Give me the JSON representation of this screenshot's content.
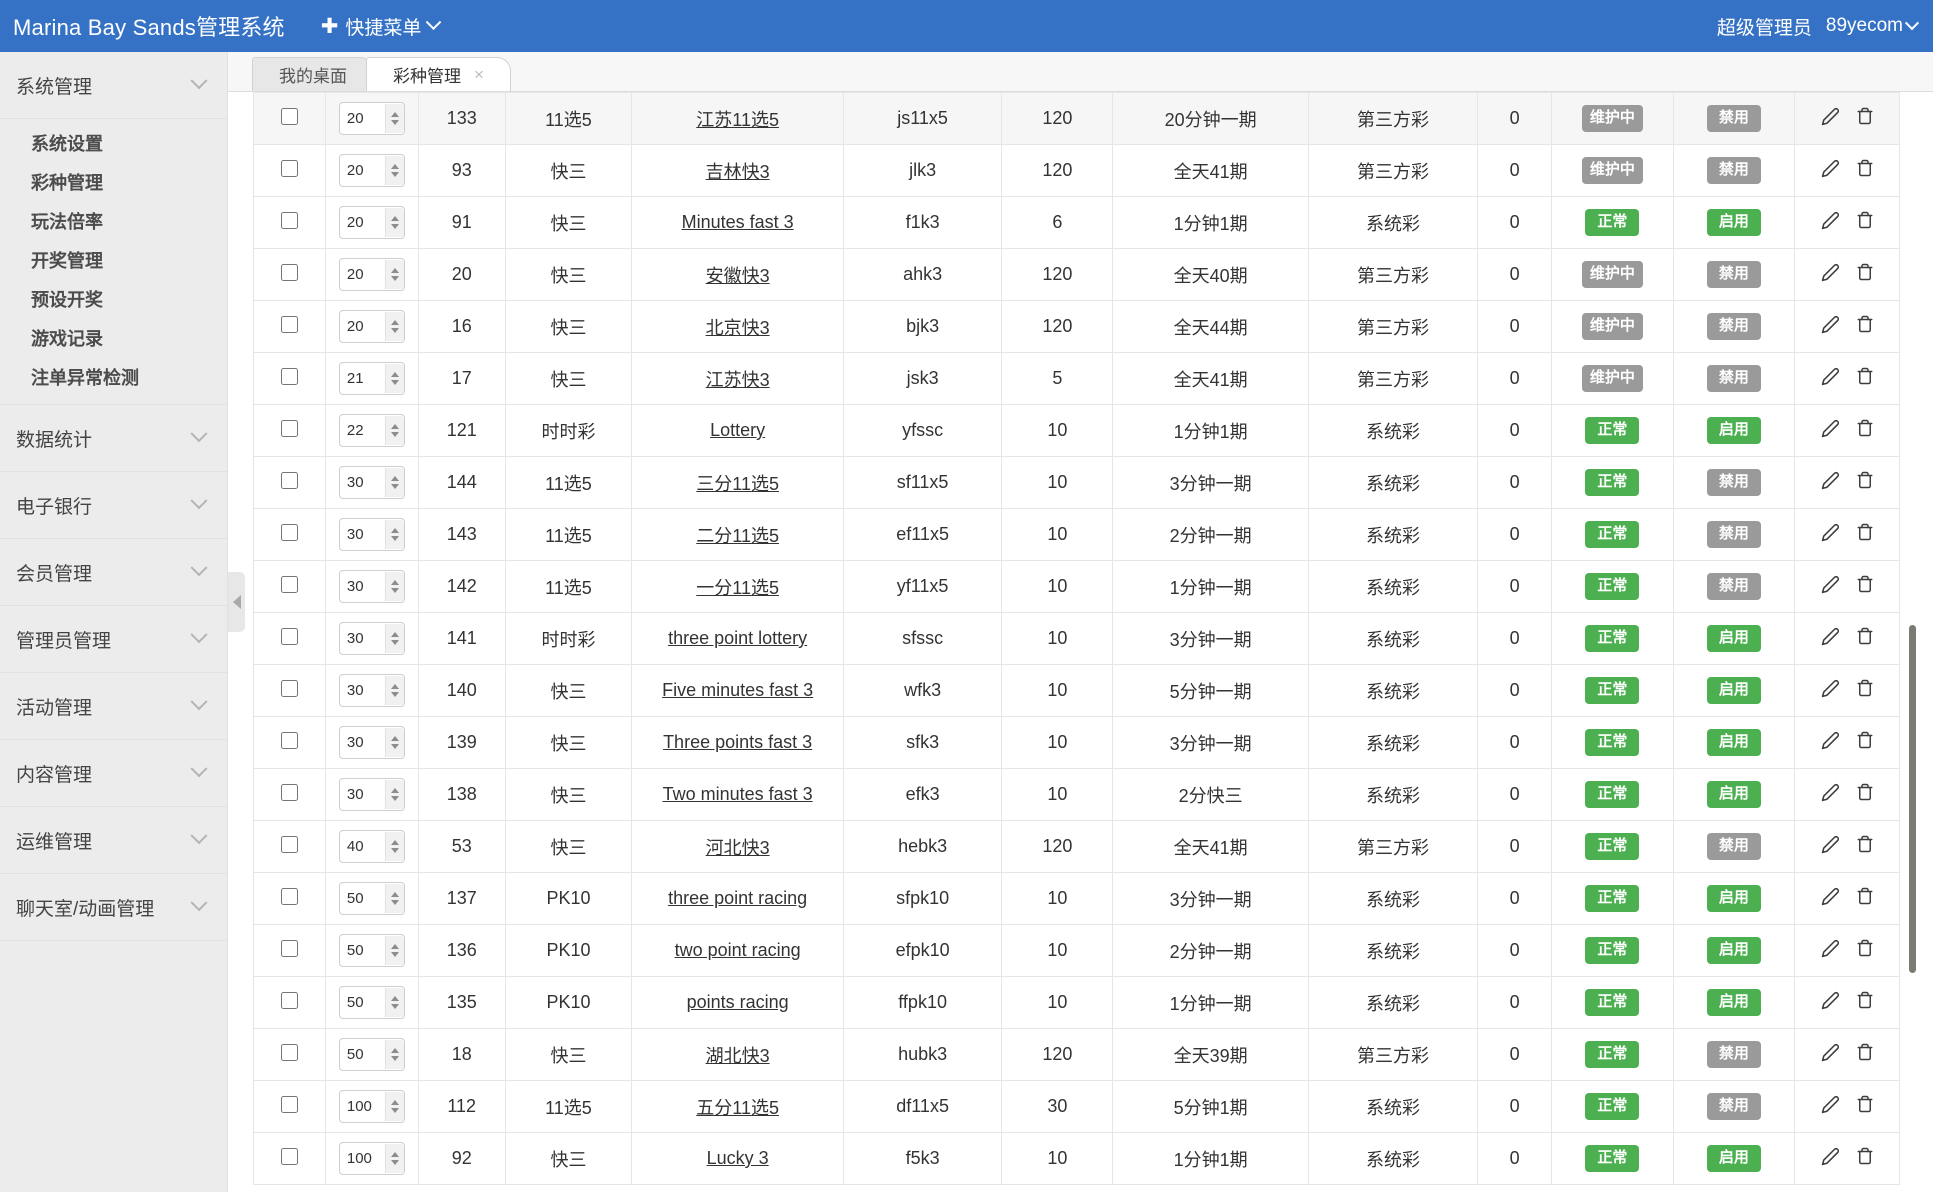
{
  "header": {
    "brand": "Marina Bay Sands管理系统",
    "quick_menu": "快捷菜单",
    "quick_menu_plus": "✚",
    "role": "超级管理员",
    "username": "89yecom"
  },
  "sidebar": {
    "groups": [
      {
        "label": "系统管理",
        "expanded": true,
        "items": [
          "系统设置",
          "彩种管理",
          "玩法倍率",
          "开奖管理",
          "预设开奖",
          "游戏记录",
          "注单异常检测"
        ]
      },
      {
        "label": "数据统计",
        "expanded": false,
        "items": []
      },
      {
        "label": "电子银行",
        "expanded": false,
        "items": []
      },
      {
        "label": "会员管理",
        "expanded": false,
        "items": []
      },
      {
        "label": "管理员管理",
        "expanded": false,
        "items": []
      },
      {
        "label": "活动管理",
        "expanded": false,
        "items": []
      },
      {
        "label": "内容管理",
        "expanded": false,
        "items": []
      },
      {
        "label": "运维管理",
        "expanded": false,
        "items": []
      },
      {
        "label": "聊天室/动画管理",
        "expanded": false,
        "items": []
      }
    ]
  },
  "tabs": [
    {
      "label": "我的桌面",
      "active": false,
      "closable": false
    },
    {
      "label": "彩种管理",
      "active": true,
      "closable": true,
      "close_icon": "×"
    }
  ],
  "colors": {
    "brand": "#3572c6",
    "status_normal": "#4caf50",
    "status_disabled": "#9a9a9a"
  },
  "table": {
    "icons": {
      "edit": "pencil-icon",
      "delete": "trash-icon"
    },
    "rows": [
      {
        "sort": "20",
        "id": "133",
        "type": "11选5",
        "name": "江苏11选5",
        "code": "js11x5",
        "num": "120",
        "freq": "20分钟一期",
        "source": "第三方彩",
        "zero": "0",
        "status": "维护中",
        "status_kind": "gray",
        "enabled": "禁用",
        "enabled_kind": "gray"
      },
      {
        "sort": "20",
        "id": "93",
        "type": "快三",
        "name": "吉林快3",
        "code": "jlk3",
        "num": "120",
        "freq": "全天41期",
        "source": "第三方彩",
        "zero": "0",
        "status": "维护中",
        "status_kind": "gray",
        "enabled": "禁用",
        "enabled_kind": "gray"
      },
      {
        "sort": "20",
        "id": "91",
        "type": "快三",
        "name": "Minutes fast 3",
        "code": "f1k3",
        "num": "6",
        "freq": "1分钟1期",
        "source": "系统彩",
        "zero": "0",
        "status": "正常",
        "status_kind": "green",
        "enabled": "启用",
        "enabled_kind": "green"
      },
      {
        "sort": "20",
        "id": "20",
        "type": "快三",
        "name": "安徽快3",
        "code": "ahk3",
        "num": "120",
        "freq": "全天40期",
        "source": "第三方彩",
        "zero": "0",
        "status": "维护中",
        "status_kind": "gray",
        "enabled": "禁用",
        "enabled_kind": "gray"
      },
      {
        "sort": "20",
        "id": "16",
        "type": "快三",
        "name": "北京快3",
        "code": "bjk3",
        "num": "120",
        "freq": "全天44期",
        "source": "第三方彩",
        "zero": "0",
        "status": "维护中",
        "status_kind": "gray",
        "enabled": "禁用",
        "enabled_kind": "gray"
      },
      {
        "sort": "21",
        "id": "17",
        "type": "快三",
        "name": "江苏快3",
        "code": "jsk3",
        "num": "5",
        "freq": "全天41期",
        "source": "第三方彩",
        "zero": "0",
        "status": "维护中",
        "status_kind": "gray",
        "enabled": "禁用",
        "enabled_kind": "gray"
      },
      {
        "sort": "22",
        "id": "121",
        "type": "时时彩",
        "name": "Lottery",
        "code": "yfssc",
        "num": "10",
        "freq": "1分钟1期",
        "source": "系统彩",
        "zero": "0",
        "status": "正常",
        "status_kind": "green",
        "enabled": "启用",
        "enabled_kind": "green"
      },
      {
        "sort": "30",
        "id": "144",
        "type": "11选5",
        "name": "三分11选5",
        "code": "sf11x5",
        "num": "10",
        "freq": "3分钟一期",
        "source": "系统彩",
        "zero": "0",
        "status": "正常",
        "status_kind": "green",
        "enabled": "禁用",
        "enabled_kind": "gray"
      },
      {
        "sort": "30",
        "id": "143",
        "type": "11选5",
        "name": "二分11选5",
        "code": "ef11x5",
        "num": "10",
        "freq": "2分钟一期",
        "source": "系统彩",
        "zero": "0",
        "status": "正常",
        "status_kind": "green",
        "enabled": "禁用",
        "enabled_kind": "gray"
      },
      {
        "sort": "30",
        "id": "142",
        "type": "11选5",
        "name": "一分11选5",
        "code": "yf11x5",
        "num": "10",
        "freq": "1分钟一期",
        "source": "系统彩",
        "zero": "0",
        "status": "正常",
        "status_kind": "green",
        "enabled": "禁用",
        "enabled_kind": "gray"
      },
      {
        "sort": "30",
        "id": "141",
        "type": "时时彩",
        "name": "three point lottery",
        "code": "sfssc",
        "num": "10",
        "freq": "3分钟一期",
        "source": "系统彩",
        "zero": "0",
        "status": "正常",
        "status_kind": "green",
        "enabled": "启用",
        "enabled_kind": "green"
      },
      {
        "sort": "30",
        "id": "140",
        "type": "快三",
        "name": "Five minutes fast 3",
        "code": "wfk3",
        "num": "10",
        "freq": "5分钟一期",
        "source": "系统彩",
        "zero": "0",
        "status": "正常",
        "status_kind": "green",
        "enabled": "启用",
        "enabled_kind": "green"
      },
      {
        "sort": "30",
        "id": "139",
        "type": "快三",
        "name": "Three points fast 3",
        "code": "sfk3",
        "num": "10",
        "freq": "3分钟一期",
        "source": "系统彩",
        "zero": "0",
        "status": "正常",
        "status_kind": "green",
        "enabled": "启用",
        "enabled_kind": "green"
      },
      {
        "sort": "30",
        "id": "138",
        "type": "快三",
        "name": "Two minutes fast 3",
        "code": "efk3",
        "num": "10",
        "freq": "2分快三",
        "source": "系统彩",
        "zero": "0",
        "status": "正常",
        "status_kind": "green",
        "enabled": "启用",
        "enabled_kind": "green"
      },
      {
        "sort": "40",
        "id": "53",
        "type": "快三",
        "name": "河北快3",
        "code": "hebk3",
        "num": "120",
        "freq": "全天41期",
        "source": "第三方彩",
        "zero": "0",
        "status": "正常",
        "status_kind": "green",
        "enabled": "禁用",
        "enabled_kind": "gray"
      },
      {
        "sort": "50",
        "id": "137",
        "type": "PK10",
        "name": "three point racing",
        "code": "sfpk10",
        "num": "10",
        "freq": "3分钟一期",
        "source": "系统彩",
        "zero": "0",
        "status": "正常",
        "status_kind": "green",
        "enabled": "启用",
        "enabled_kind": "green"
      },
      {
        "sort": "50",
        "id": "136",
        "type": "PK10",
        "name": "two point racing",
        "code": "efpk10",
        "num": "10",
        "freq": "2分钟一期",
        "source": "系统彩",
        "zero": "0",
        "status": "正常",
        "status_kind": "green",
        "enabled": "启用",
        "enabled_kind": "green"
      },
      {
        "sort": "50",
        "id": "135",
        "type": "PK10",
        "name": "points racing",
        "code": "ffpk10",
        "num": "10",
        "freq": "1分钟一期",
        "source": "系统彩",
        "zero": "0",
        "status": "正常",
        "status_kind": "green",
        "enabled": "启用",
        "enabled_kind": "green"
      },
      {
        "sort": "50",
        "id": "18",
        "type": "快三",
        "name": "湖北快3",
        "code": "hubk3",
        "num": "120",
        "freq": "全天39期",
        "source": "第三方彩",
        "zero": "0",
        "status": "正常",
        "status_kind": "green",
        "enabled": "禁用",
        "enabled_kind": "gray"
      },
      {
        "sort": "100",
        "id": "112",
        "type": "11选5",
        "name": "五分11选5",
        "code": "df11x5",
        "num": "30",
        "freq": "5分钟1期",
        "source": "系统彩",
        "zero": "0",
        "status": "正常",
        "status_kind": "green",
        "enabled": "禁用",
        "enabled_kind": "gray"
      },
      {
        "sort": "100",
        "id": "92",
        "type": "快三",
        "name": "Lucky 3",
        "code": "f5k3",
        "num": "10",
        "freq": "1分钟1期",
        "source": "系统彩",
        "zero": "0",
        "status": "正常",
        "status_kind": "green",
        "enabled": "启用",
        "enabled_kind": "green"
      }
    ]
  }
}
